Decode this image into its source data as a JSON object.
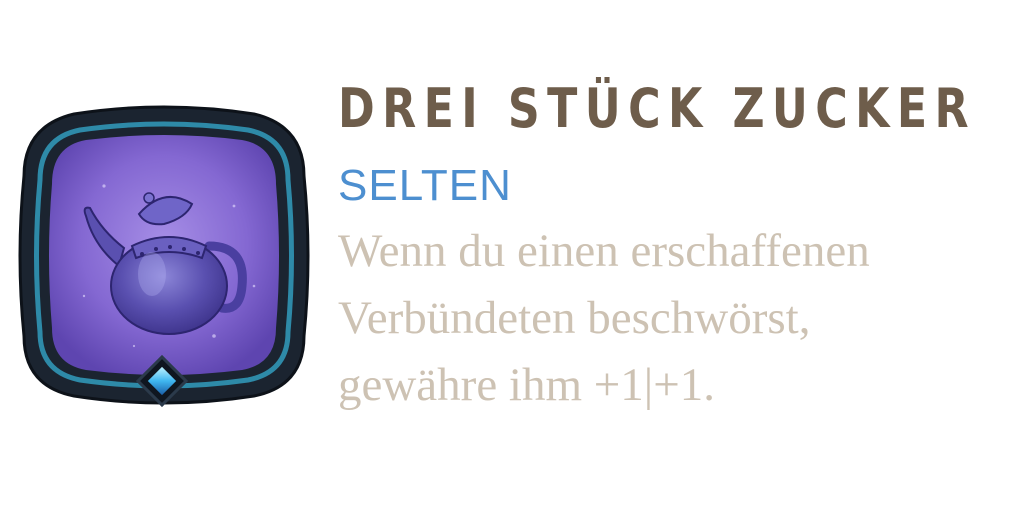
{
  "card": {
    "title": "DREI STÜCK ZUCKER",
    "rarity": "SELTEN",
    "description_lines": [
      "Wenn du einen erschaffenen",
      "Verbündeten beschwörst,",
      "gewähre ihm +1|+1."
    ],
    "icon": "teapot-icon",
    "gem": "gem-icon"
  },
  "colors": {
    "title": "#6e5d4b",
    "rarity": "#4d8fd0",
    "description": "#cdc2b3",
    "frame_dark": "#1b2430",
    "frame_teal": "#2e8aa8",
    "frame_gold": "#a08660",
    "icon_bg": "#8a6fd6"
  }
}
